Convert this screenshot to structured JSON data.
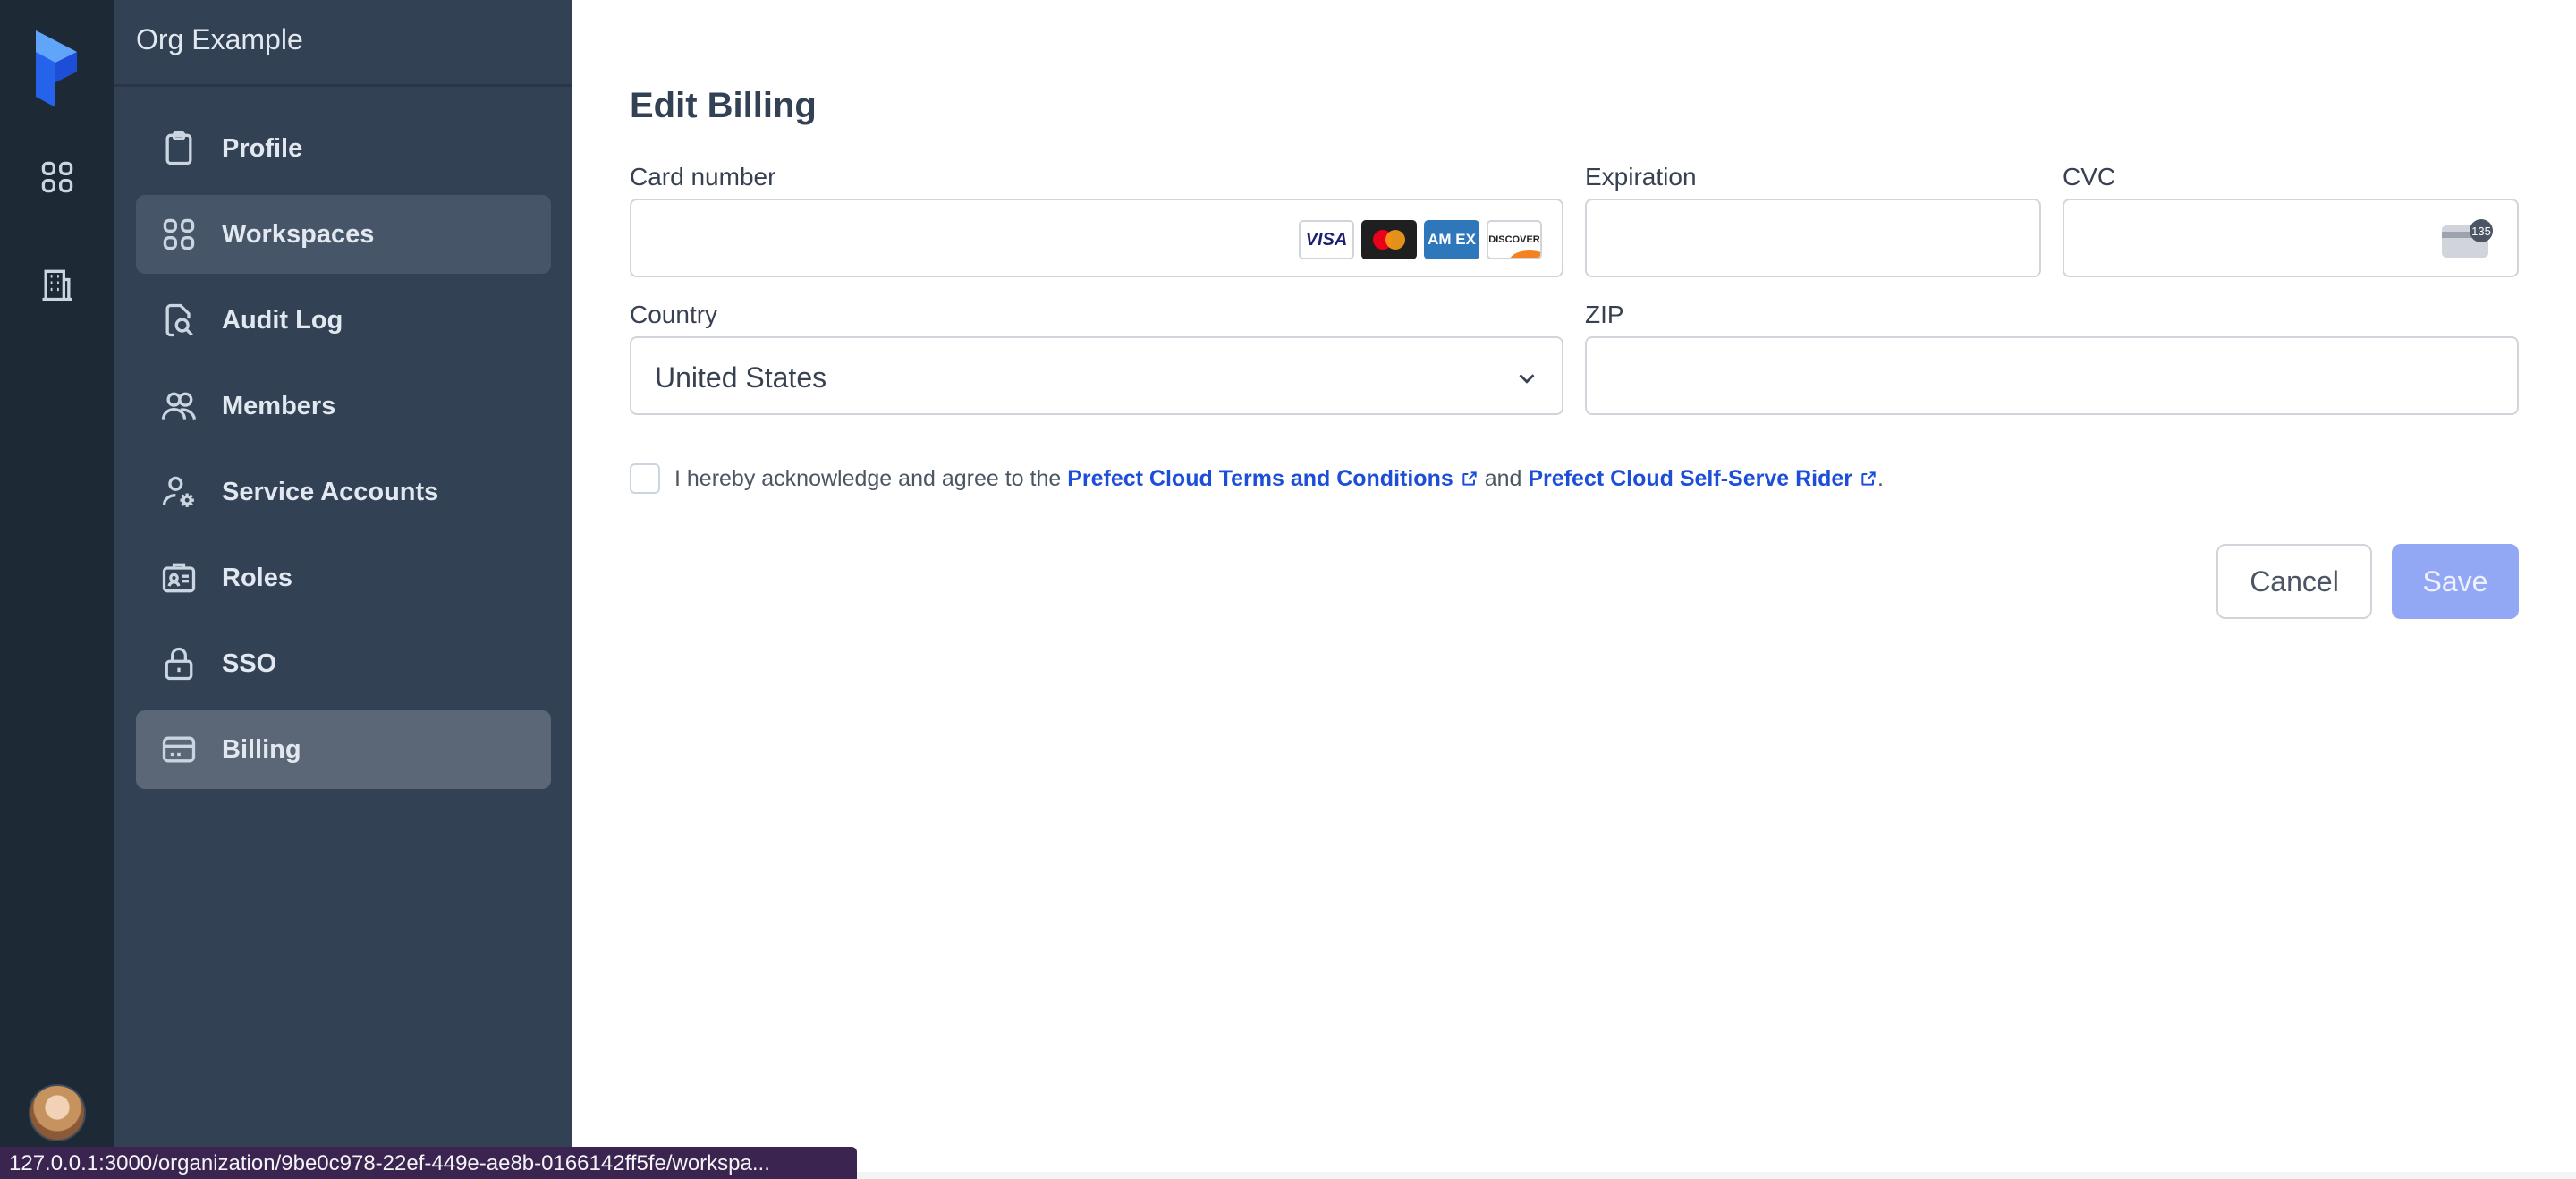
{
  "org": {
    "name": "Org Example"
  },
  "sidebar": {
    "items": [
      {
        "label": "Profile",
        "icon": "clipboard-icon"
      },
      {
        "label": "Workspaces",
        "icon": "grid-icon"
      },
      {
        "label": "Audit Log",
        "icon": "document-search-icon"
      },
      {
        "label": "Members",
        "icon": "users-icon"
      },
      {
        "label": "Service Accounts",
        "icon": "user-gear-icon"
      },
      {
        "label": "Roles",
        "icon": "id-card-icon"
      },
      {
        "label": "SSO",
        "icon": "lock-icon"
      },
      {
        "label": "Billing",
        "icon": "credit-card-icon"
      }
    ],
    "hovered": "Workspaces",
    "active": "Billing"
  },
  "form": {
    "title": "Edit Billing",
    "card_number": {
      "label": "Card number",
      "value": ""
    },
    "card_brands": [
      "VISA",
      "AM EX",
      "DISCOVER"
    ],
    "expiration": {
      "label": "Expiration",
      "value": ""
    },
    "cvc": {
      "label": "CVC",
      "value": "",
      "hint": "135"
    },
    "country": {
      "label": "Country",
      "value": "United States"
    },
    "zip": {
      "label": "ZIP",
      "value": ""
    },
    "agreement": {
      "checked": false,
      "prefix": "I hereby acknowledge and agree to the",
      "link1": "Prefect Cloud Terms and Conditions",
      "middle": "and",
      "link2": "Prefect Cloud Self-Serve Rider",
      "suffix": "."
    },
    "cancel_label": "Cancel",
    "save_label": "Save"
  },
  "status_url": "127.0.0.1:3000/organization/9be0c978-22ef-449e-ae8b-0166142ff5fe/workspa...",
  "colors": {
    "rail": "#1e2936",
    "sidebar": "#334155",
    "link": "#1d4ed8",
    "save_disabled": "#93a8f4"
  }
}
